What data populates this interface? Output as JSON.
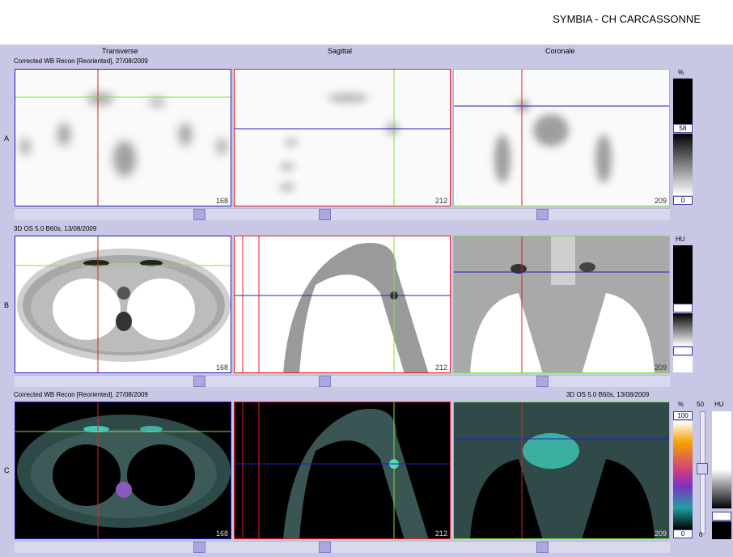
{
  "header": {
    "title": "SYMBIA - CH CARCASSONNE"
  },
  "columns": [
    "Transverse",
    "Sagittal",
    "Coronale"
  ],
  "rows": {
    "A": {
      "label": "A",
      "info": "Corrected WB Recon [Reoriented], 27/08/2009"
    },
    "B": {
      "label": "B",
      "info": "3D  OS  5.0  B60s, 13/08/2009"
    },
    "C": {
      "label": "C",
      "info_left": "Corrected WB Recon [Reoriented], 27/08/2009",
      "info_right": "3D  OS  5.0  B60s, 13/08/2009"
    }
  },
  "slices": {
    "transverse": "168",
    "sagittal": "212",
    "coronale": "209"
  },
  "scales": {
    "A": {
      "unit": "%",
      "value": "58",
      "min": "0"
    },
    "B": {
      "unit": "HU"
    },
    "C": {
      "unit": "%",
      "unit2": "HU",
      "max": "100",
      "window": "50",
      "min": "0",
      "min2": "0"
    }
  },
  "colors": {
    "background": "#c8c8e6",
    "crosshair_red": "#e02020",
    "crosshair_green": "#80e040",
    "crosshair_blue": "#2020c0",
    "header": "#ffffff"
  }
}
